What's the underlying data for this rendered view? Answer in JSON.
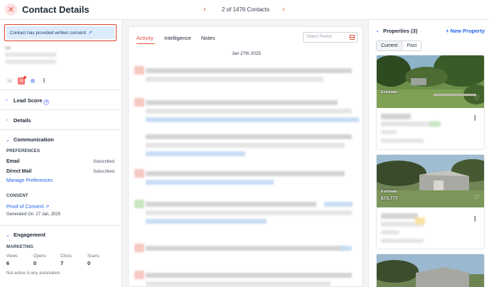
{
  "header": {
    "close_icon": "close-icon",
    "title": "Contact Details",
    "prev_icon": "‹",
    "next_icon": "›",
    "counter": "2 of 1476 Contacts"
  },
  "left": {
    "consent_text": "Contact has provided written consent",
    "external_link_icon": "↗",
    "action_icons": [
      "phone-icon",
      "email-icon",
      "chat-icon",
      "more-icon"
    ],
    "sections": {
      "lead_score": "Lead Score",
      "details": "Details",
      "communication": "Communication",
      "engagement": "Engagement"
    },
    "preferences_label": "PREFERENCES",
    "preferences": [
      {
        "name": "Email",
        "status": "Subscribed"
      },
      {
        "name": "Direct Mail",
        "status": "Subscribed"
      }
    ],
    "manage_preferences": "Manage Preferences",
    "consent_label": "CONSENT",
    "proof_of_consent": "Proof of Consent",
    "generated_on": "Generated On: 27 Jan, 2025",
    "marketing_label": "MARKETING",
    "stats": [
      {
        "label": "Views",
        "value": "6"
      },
      {
        "label": "Opens",
        "value": "0"
      },
      {
        "label": "Clicks",
        "value": "7"
      },
      {
        "label": "Scans",
        "value": "0"
      }
    ],
    "automation_text": "Not active in any automation"
  },
  "center": {
    "tabs": [
      {
        "label": "Activity",
        "active": true
      },
      {
        "label": "Intelligence",
        "active": false
      },
      {
        "label": "Notes",
        "active": false
      }
    ],
    "period_placeholder": "Select Period",
    "date_header": "Jan 27th 2025"
  },
  "right": {
    "title": "Properties (3)",
    "new_property": "+ New Property",
    "toggle": [
      "Current",
      "Past"
    ],
    "cards": [
      {
        "estimate_label": "Estimate",
        "price": ""
      },
      {
        "estimate_label": "Estimate",
        "price": "$73,777"
      }
    ]
  },
  "colors": {
    "accent": "#e0533d",
    "link": "#2563eb",
    "consent_bg": "#dcecfb",
    "consent_border": "#d9432b"
  }
}
